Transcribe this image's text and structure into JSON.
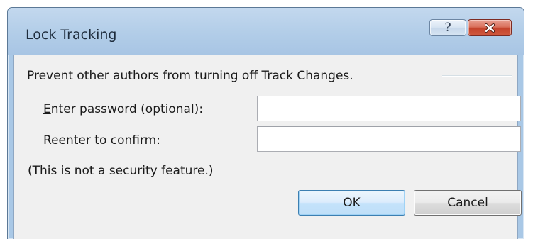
{
  "dialog": {
    "title": "Lock Tracking",
    "help_glyph": "?",
    "help_icon": "help-icon",
    "close_icon": "close-icon",
    "close_color": "#c7432f"
  },
  "content": {
    "group_label": "Prevent other authors from turning off Track Changes.",
    "password": {
      "label_accel": "E",
      "label_rest": "nter password (optional):",
      "value": ""
    },
    "confirm": {
      "label_accel": "R",
      "label_rest": "eenter to confirm:",
      "value": ""
    },
    "note": "(This is not a security feature.)"
  },
  "buttons": {
    "ok_label": "OK",
    "cancel_label": "Cancel"
  }
}
